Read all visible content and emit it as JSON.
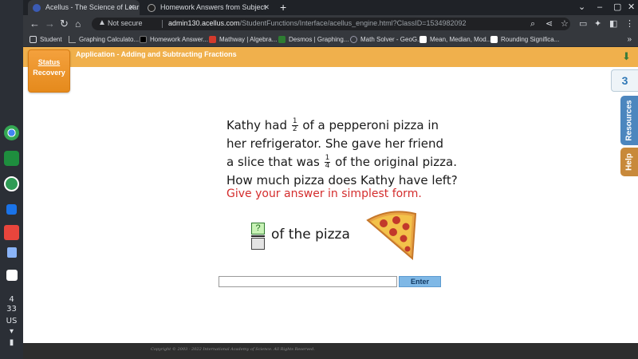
{
  "browser": {
    "tabs": [
      {
        "title": "Acellus - The Science of Learning",
        "active": true
      },
      {
        "title": "Homework Answers from Subject",
        "active": false
      }
    ],
    "new_tab_symbol": "+",
    "address_bar": {
      "security_label": "Not secure",
      "host": "admin130.acellus.com",
      "path": "/StudentFunctions/Interface/acellus_engine.html?ClassID=1534982092"
    },
    "bookmarks": [
      {
        "label": "Student",
        "icon": "folder-icon"
      },
      {
        "label": "Graphing Calculato...",
        "icon": "graph-icon"
      },
      {
        "label": "Homework Answer...",
        "icon": "homework-icon"
      },
      {
        "label": "Mathway | Algebra...",
        "icon": "mathway-icon"
      },
      {
        "label": "Desmos | Graphing...",
        "icon": "desmos-icon"
      },
      {
        "label": "Math Solver - GeoG...",
        "icon": "geogebra-icon"
      },
      {
        "label": "Mean, Median, Mod...",
        "icon": "sigma-icon"
      },
      {
        "label": "Rounding Significa...",
        "icon": "sigma-icon"
      }
    ],
    "bookmarks_more": "»"
  },
  "shelf": {
    "status_time_hour": "4",
    "status_time_minute": "33",
    "status_locale": "US"
  },
  "acellus": {
    "lesson_title": "Application - Adding and Subtracting Fractions",
    "status_label": "Status",
    "status_value": "Recovery",
    "question_count": "3",
    "resources_label": "Resources",
    "help_label": "Help",
    "question": {
      "line1_pre": "Kathy had",
      "frac1_num": "1",
      "frac1_den": "2",
      "line1_post": "of a pepperoni pizza in",
      "line2": "her refrigerator. She gave her friend",
      "line3_pre": "a slice that was",
      "frac2_num": "1",
      "frac2_den": "4",
      "line3_post": "of the original pizza.",
      "line4": "How much pizza does Kathy have left?"
    },
    "instruction": "Give your answer in simplest form.",
    "answer_numerator_placeholder": "?",
    "answer_suffix": "of the pizza",
    "answer_input_value": "",
    "enter_label": "Enter",
    "footer": "Copyright © 2003 - 2022 International Academy of Science.  All Rights Reserved."
  },
  "colors": {
    "orange_bar": "#f0b04c",
    "instruction_red": "#d42d2d",
    "enter_blue": "#7fb8e6",
    "resources_blue": "#4c86be",
    "help_orange": "#c8893a"
  }
}
